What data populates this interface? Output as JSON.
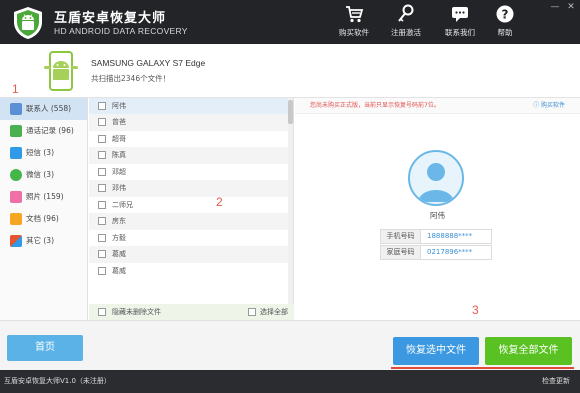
{
  "app": {
    "title": "互盾安卓恢复大师",
    "subtitle": "HD ANDROID DATA RECOVERY"
  },
  "toolbar": {
    "buy": "购买软件",
    "activate": "注册激活",
    "contact": "联系我们",
    "help": "帮助"
  },
  "device": {
    "name": "SAMSUNG  GALAXY S7 Edge",
    "scan_status": "共扫描出2346个文件！"
  },
  "markers": {
    "one": "1",
    "two": "2",
    "three": "3"
  },
  "categories": [
    {
      "label": "联系人 (558)",
      "icon": "contacts-icon",
      "color": "#5b8fd6"
    },
    {
      "label": "通话记录 (96)",
      "icon": "phone-icon",
      "color": "#4caf50"
    },
    {
      "label": "短信 (3)",
      "icon": "sms-icon",
      "color": "#2f9be8"
    },
    {
      "label": "微信 (3)",
      "icon": "wechat-icon",
      "color": "#44b549"
    },
    {
      "label": "照片 (159)",
      "icon": "photo-icon",
      "color": "#ef6fa6"
    },
    {
      "label": "文档 (96)",
      "icon": "document-icon",
      "color": "#f5a623"
    },
    {
      "label": "其它 (3)",
      "icon": "other-icon",
      "color": "#e5552e"
    }
  ],
  "contacts": [
    "阿伟",
    "曾爸",
    "超哥",
    "陈真",
    "邓超",
    "邓伟",
    "二师兄",
    "房东",
    "方毅",
    "葛威",
    "葛威"
  ],
  "list_footer": {
    "hide_deleted": "隐藏未删除文件",
    "select_all": "选择全部"
  },
  "detail": {
    "notice": "您尚未购买正式版，当前只显示恢复号码前7位。",
    "buy_link": "购买软件",
    "name": "阿伟",
    "fields": [
      {
        "key": "手机号码",
        "value": "1888888****"
      },
      {
        "key": "家庭号码",
        "value": "0217896****"
      }
    ]
  },
  "actions": {
    "home": "首页",
    "recover_selected": "恢复选中文件",
    "recover_all": "恢复全部文件"
  },
  "statusbar": {
    "version": "互盾安卓恢复大师V1.0（未注册）",
    "check_update": "检查更新"
  }
}
